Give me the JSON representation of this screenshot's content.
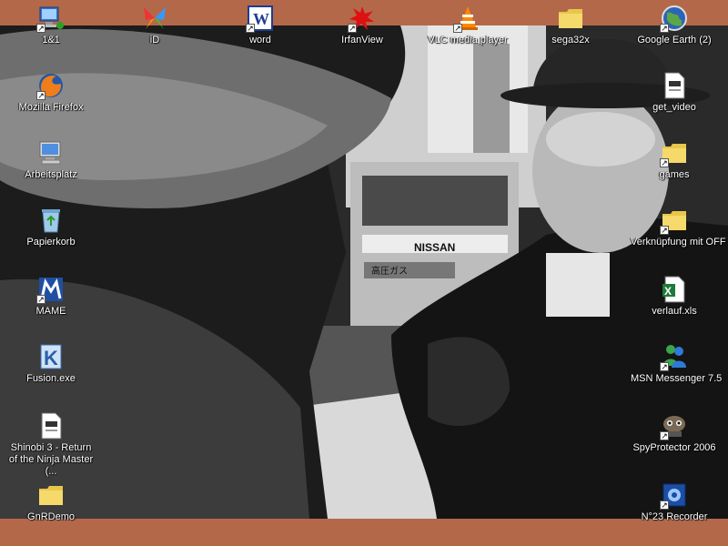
{
  "desktop": {
    "background_color": "#b4684a",
    "wallpaper": {
      "description_text": "NISSAN",
      "plate_text": "高圧ガス"
    },
    "icons": [
      {
        "label": "1&1",
        "icon": "network-computer-icon"
      },
      {
        "label": "iD",
        "icon": "colorful-butterfly-icon"
      },
      {
        "label": "word",
        "icon": "word-document-icon"
      },
      {
        "label": "IrfanView",
        "icon": "red-splat-icon"
      },
      {
        "label": "VLC media player",
        "icon": "vlc-cone-icon"
      },
      {
        "label": "sega32x",
        "icon": "folder-icon"
      },
      {
        "label": "Google Earth (2)",
        "icon": "globe-icon"
      },
      {
        "label": "Mozilla Firefox",
        "icon": "firefox-icon"
      },
      {
        "label": "get_video",
        "icon": "file-icon"
      },
      {
        "label": "Arbeitsplatz",
        "icon": "my-computer-icon"
      },
      {
        "label": "games",
        "icon": "folder-icon"
      },
      {
        "label": "Papierkorb",
        "icon": "recycle-bin-icon"
      },
      {
        "label": "Verknüpfung mit OFF",
        "icon": "folder-icon"
      },
      {
        "label": "MAME",
        "icon": "mame-icon"
      },
      {
        "label": "verlauf.xls",
        "icon": "excel-icon"
      },
      {
        "label": "Fusion.exe",
        "icon": "fusion-k-icon"
      },
      {
        "label": "MSN Messenger 7.5",
        "icon": "msn-messenger-icon"
      },
      {
        "label": "Shinobi 3 - Return of the Ninja Master (...",
        "icon": "file-icon"
      },
      {
        "label": "SpyProtector 2006",
        "icon": "spyprotector-icon"
      },
      {
        "label": "GnRDemo",
        "icon": "folder-icon"
      },
      {
        "label": "N°23 Recorder",
        "icon": "recorder-icon"
      }
    ]
  }
}
